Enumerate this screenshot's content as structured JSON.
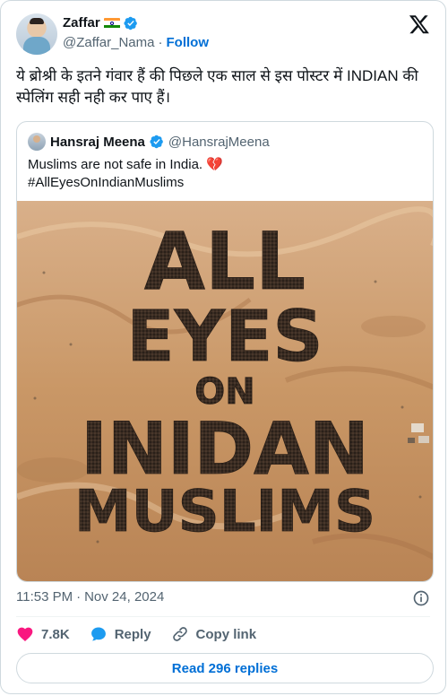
{
  "author": {
    "name": "Zaffar",
    "flag_icon": "india-flag-icon",
    "handle": "@Zaffar_Nama",
    "separator": "·",
    "follow_label": "Follow"
  },
  "tweet": {
    "text": "ये ब्रोश्री के इतने गंवार हैं की पिछले एक साल से इस पोस्टर में INDIAN की स्पेलिंग सही नही कर पाए हैं।"
  },
  "quoted": {
    "name": "Hansraj Meena",
    "handle": "@HansrajMeena",
    "line1": "Muslims are not safe in India. 💔",
    "line2": "#AllEyesOnIndianMuslims",
    "image_words": [
      "ALL",
      "EYES",
      "ON",
      "INIDAN",
      "MUSLIMS"
    ]
  },
  "meta": {
    "time": "11:53 PM",
    "separator": "·",
    "date": "Nov 24, 2024"
  },
  "actions": {
    "likes": "7.8K",
    "reply_label": "Reply",
    "copy_label": "Copy link"
  },
  "read_replies_label": "Read 296 replies",
  "colors": {
    "accent": "#006fd6",
    "like": "#f91880",
    "verified": "#1d9bf0",
    "sand": "#c99766"
  }
}
